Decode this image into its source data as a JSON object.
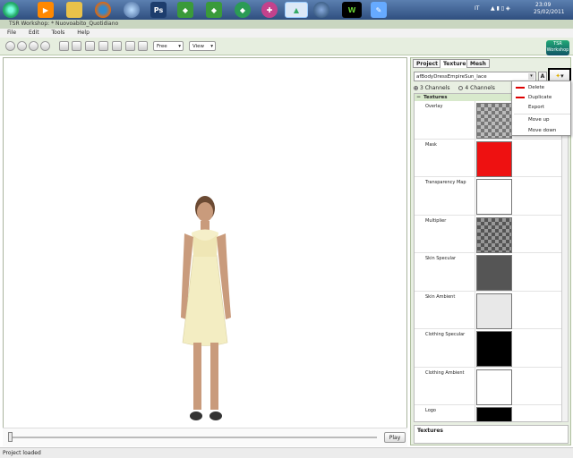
{
  "taskbar": {
    "icons": [
      "start-orb",
      "media-player",
      "folder",
      "firefox",
      "explorer",
      "photoshop",
      "sims-app",
      "sims-app-2",
      "sims-app-3",
      "sims-app-4",
      "workshop-active",
      "web-app",
      "w-app",
      "paint-app"
    ],
    "language": "IT",
    "time": "23:09",
    "date": "25/02/2011"
  },
  "window": {
    "title": "TSR Workshop: * Nuovoabito_Quotidiano"
  },
  "menu": {
    "file": "File",
    "edit": "Edit",
    "tools": "Tools",
    "help": "Help"
  },
  "toolbar": {
    "free_label": "Free",
    "view_label": "View"
  },
  "logo": {
    "line1": "TSR",
    "line2": "Workshop"
  },
  "viewport": {
    "play_label": "Play",
    "timeline_position": 0
  },
  "panel": {
    "tabs": [
      "Project",
      "Texture",
      "Mesh"
    ],
    "active_tab": "Texture",
    "texture_name": "afBodyDressEmpireSun_lace",
    "a_button": "A",
    "channels": {
      "three": "3 Channels",
      "four": "4 Channels"
    },
    "group_label": "Textures",
    "textures": [
      {
        "label": "Overlay",
        "swatch": "checker"
      },
      {
        "label": "Mask",
        "swatch": "#ee1111"
      },
      {
        "label": "Transparency Map",
        "swatch": "#ffffff"
      },
      {
        "label": "Multiplier",
        "swatch": "checker-dark"
      },
      {
        "label": "Skin Specular",
        "swatch": "#555555"
      },
      {
        "label": "Skin Ambient",
        "swatch": "#e8e8e8"
      },
      {
        "label": "Clothing Specular",
        "swatch": "#000000"
      },
      {
        "label": "Clothing Ambient",
        "swatch": "#ffffff"
      },
      {
        "label": "Logo",
        "swatch": "#000000"
      }
    ],
    "bottom_title": "Textures"
  },
  "context_menu": {
    "delete": "Delete",
    "duplicate": "Duplicate",
    "export": "Export",
    "move_up": "Move up",
    "move_down": "Move down"
  },
  "status": {
    "text": "Project loaded"
  },
  "colors": {
    "panel_bg": "#e8efe2",
    "accent_green": "#9bc07a",
    "mask_red": "#ee1111"
  }
}
